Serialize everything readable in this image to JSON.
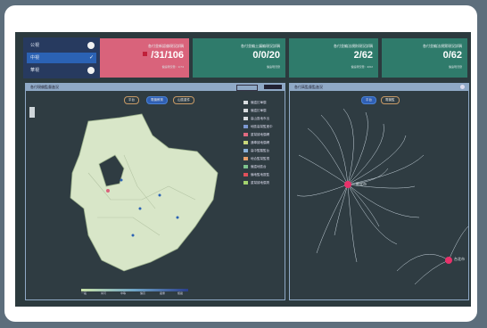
{
  "legend": {
    "rows": [
      {
        "label": "公視",
        "state": "on"
      },
      {
        "label": "中視",
        "state": "selected"
      },
      {
        "label": "華視",
        "state": "on"
      }
    ]
  },
  "cards": [
    {
      "title": "各付並新認偏現況詳稱",
      "value": "/31/106",
      "sub": "偏遠現況發 ∶ 1∕74",
      "color": "#d9637b"
    },
    {
      "title": "各付並編土議編現況詳稱",
      "value": "0/0/20",
      "sub": "偏遠現況發",
      "color": "#2f7b6b"
    },
    {
      "title": "各付並編法規則現況詳稱",
      "value": "2/62",
      "sub": "偏遠現況發 ∶ 4∕62",
      "color": "#2f7b6b"
    },
    {
      "title": "各付並編法規實現況詳稱",
      "value": "0/62",
      "sub": "偏遠現況發",
      "color": "#2f7b6b"
    }
  ],
  "left_panel": {
    "title": "各付現偏監督進況",
    "btn1": "平台",
    "btn2": "電機教育",
    "btn3": "山區重件",
    "legend": [
      "偏遠訂單價",
      "偏遠訂單價",
      "高山區地市出",
      "地區高幫監進中",
      "重幫據地價網",
      "通車據地價網",
      "高中監驅監台",
      "地合監幫監視",
      "偏遠地區台",
      "偏地監地區監",
      "重幫據地價測"
    ]
  },
  "right_panel": {
    "title": "各付高監督監進況",
    "btn1": "平台",
    "btn2": "電機監"
  },
  "graph": {
    "hub": "新北市",
    "hub2": "台北市",
    "colors": {
      "hub": "#e8316a",
      "edge": "#c9d6de"
    }
  },
  "scale_labels": [
    "一般",
    "尚可",
    "中等",
    "偏高",
    "嚴重",
    "極嚴"
  ]
}
